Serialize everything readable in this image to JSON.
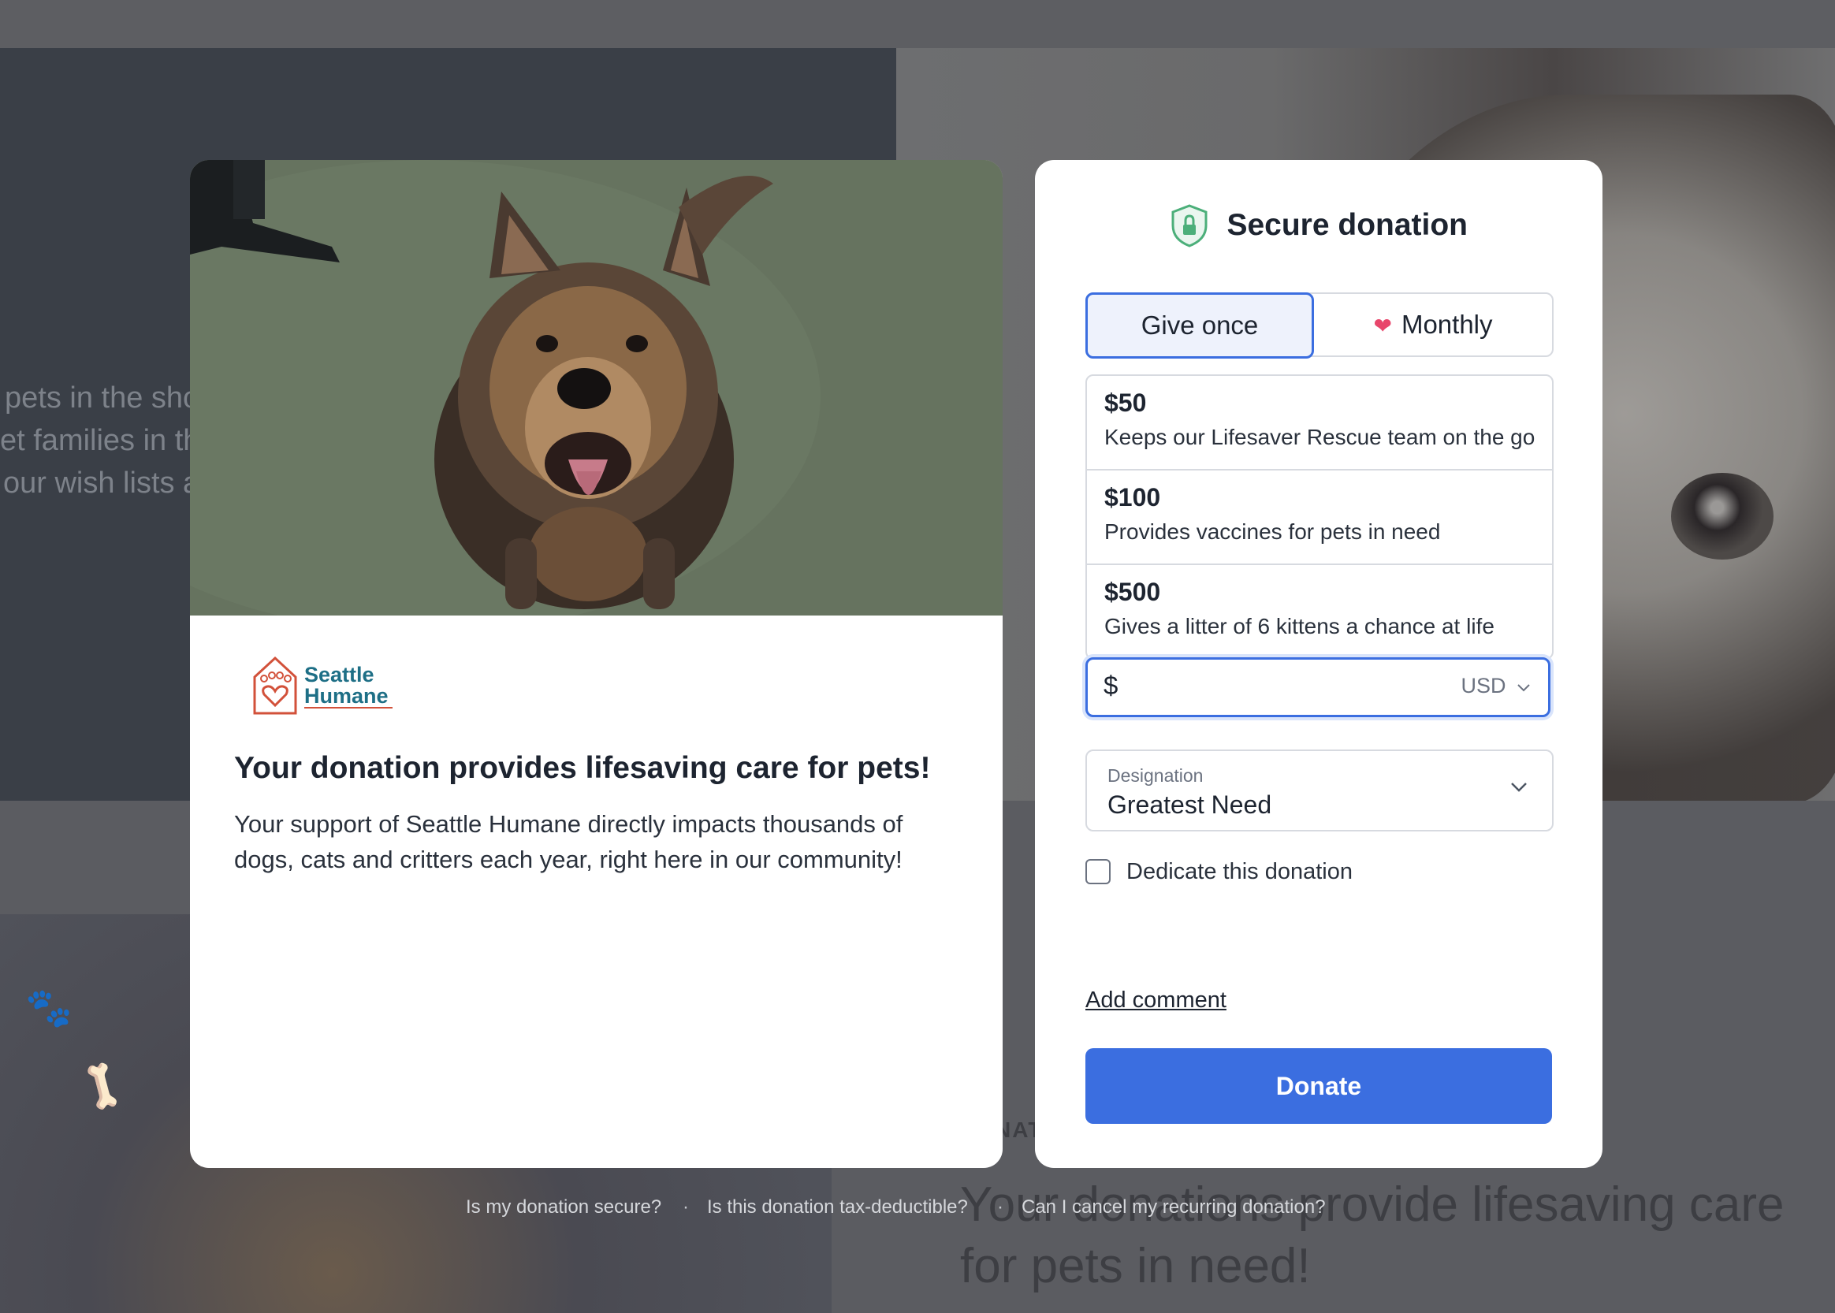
{
  "background": {
    "text_lines": [
      "pets in the sho",
      "et families in th",
      "our wish lists a"
    ],
    "tagline": "NAT",
    "heading": "Your donations provide lifesaving care for pets in need!"
  },
  "info_card": {
    "logo": {
      "line1": "Seattle",
      "line2": "Humane"
    },
    "title": "Your donation provides lifesaving care for pets!",
    "body": "Your support of Seattle Humane directly impacts thousands of dogs, cats and critters each year, right here in our community!"
  },
  "donation_card": {
    "title": "Secure donation",
    "frequency": {
      "once_label": "Give once",
      "monthly_label": "Monthly"
    },
    "amounts": [
      {
        "value": "$50",
        "description": "Keeps our Lifesaver Rescue team on the go"
      },
      {
        "value": "$100",
        "description": "Provides vaccines for pets in need"
      },
      {
        "value": "$500",
        "description": "Gives a litter of 6 kittens a chance at life"
      }
    ],
    "custom_amount": {
      "symbol": "$",
      "value": "",
      "currency": "USD"
    },
    "designation": {
      "label": "Designation",
      "value": "Greatest Need"
    },
    "dedicate_label": "Dedicate this donation",
    "add_comment_label": "Add comment",
    "donate_label": "Donate"
  },
  "faq_links": [
    "Is my donation secure?",
    "Is this donation tax-deductible?",
    "Can I cancel my recurring donation?"
  ],
  "colors": {
    "accent": "#3b6ee0",
    "heart": "#e8466b",
    "shield": "#4caf7a"
  }
}
